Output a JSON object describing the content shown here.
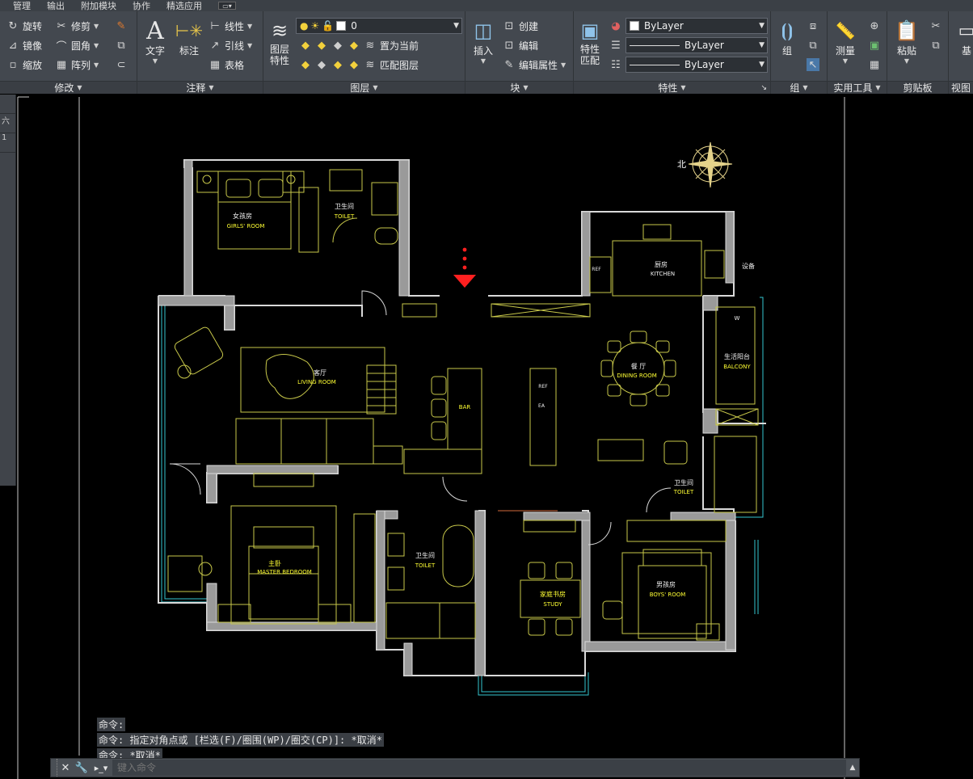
{
  "menu": [
    "管理",
    "输出",
    "附加模块",
    "协作",
    "精选应用"
  ],
  "ribbon": {
    "modify": {
      "title": "修改",
      "tools": [
        "旋转",
        "修剪",
        "镜像",
        "圆角",
        "缩放",
        "阵列"
      ]
    },
    "annotation": {
      "title": "注释",
      "text": "文字",
      "dimension": "标注",
      "linear": "线性",
      "leader": "引线",
      "table": "表格"
    },
    "layers": {
      "title": "图层",
      "layer_props": "图层\n特性",
      "current_layer": "0",
      "set_current": "置为当前",
      "match_layer": "匹配图层"
    },
    "block": {
      "title": "块",
      "insert": "插入",
      "create": "创建",
      "edit": "编辑",
      "edit_attr": "编辑属性"
    },
    "properties": {
      "title": "特性",
      "match": "特性\n匹配",
      "color": "ByLayer",
      "linetype": "ByLayer",
      "lineweight": "ByLayer"
    },
    "groups": {
      "title": "组",
      "group": "组"
    },
    "utilities": {
      "title": "实用工具",
      "measure": "测量"
    },
    "clipboard": {
      "title": "剪贴板",
      "paste": "粘贴"
    },
    "view": {
      "title": "视图",
      "base": "基"
    }
  },
  "left_stub": [
    "",
    "六",
    "1"
  ],
  "drawing": {
    "rooms": [
      {
        "cn": "女孩房",
        "en": "GIRLS' ROOM"
      },
      {
        "cn": "卫生间",
        "en": "TOILET"
      },
      {
        "cn": "厨房",
        "en": "KITCHEN"
      },
      {
        "cn": "设备",
        "en": ""
      },
      {
        "cn": "客厅",
        "en": "LIVING ROOM"
      },
      {
        "cn": "餐 厅",
        "en": "DINING ROOM"
      },
      {
        "cn": "生活阳台",
        "en": "BALCONY"
      },
      {
        "cn": "卫生间",
        "en": "TOILET"
      },
      {
        "cn": "主卧",
        "en": "MASTER BEDROOM"
      },
      {
        "cn": "卫生间",
        "en": "TOILET"
      },
      {
        "cn": "家庭书房",
        "en": "STUDY"
      },
      {
        "cn": "男孩房",
        "en": "BOYS' ROOM"
      }
    ],
    "labels": {
      "ref1": "REF",
      "ref2": "REF",
      "ea": "EA",
      "bar": "BAR",
      "w": "W",
      "north": "北"
    }
  },
  "command": {
    "history": [
      "命令:",
      "命令: 指定对角点或 [栏选(F)/圈围(WP)/圈交(CP)]: *取消*",
      "命令: *取消*"
    ],
    "placeholder": "键入命令"
  }
}
